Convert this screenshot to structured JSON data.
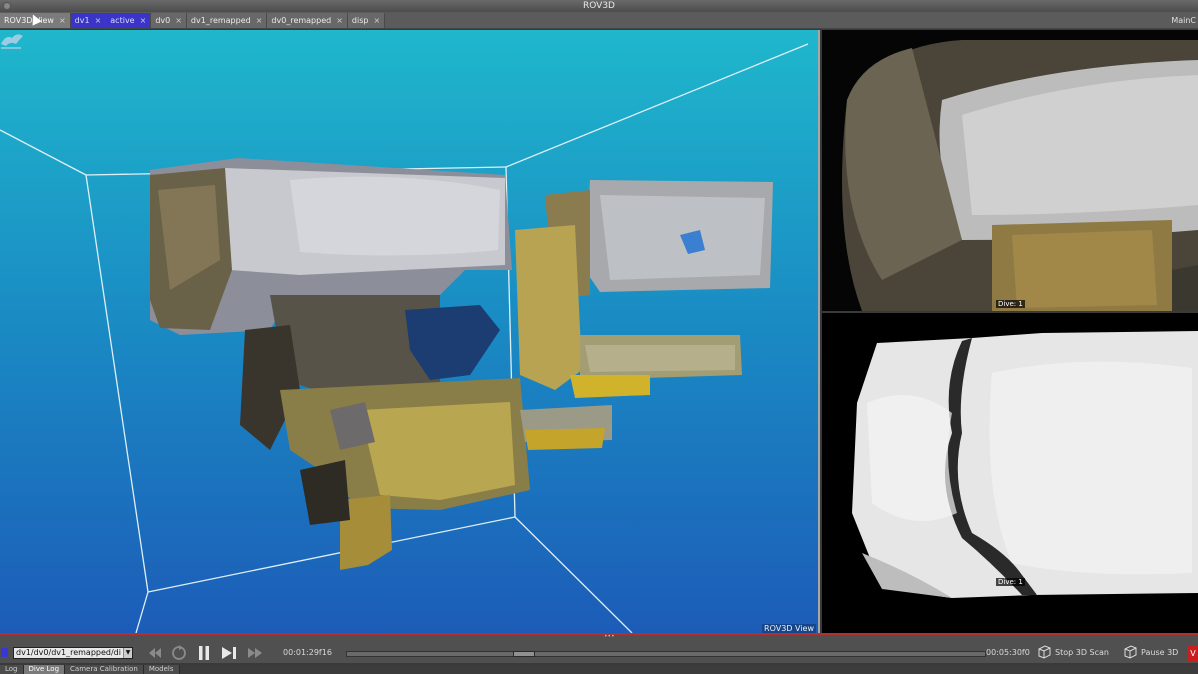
{
  "window": {
    "title": "ROV3D"
  },
  "tabs": [
    {
      "label": "ROV3D View",
      "style": "first"
    },
    {
      "label": "dv1",
      "style": "hl"
    },
    {
      "label": "active",
      "style": "hl"
    },
    {
      "label": "dv0",
      "style": "normal"
    },
    {
      "label": "dv1_remapped",
      "style": "normal"
    },
    {
      "label": "dv0_remapped",
      "style": "normal"
    },
    {
      "label": "disp",
      "style": "normal"
    }
  ],
  "tab_close": "×",
  "main_label": "MainC",
  "view3d": {
    "label": "ROV3D View"
  },
  "right_top": {
    "badge": "Dive: 1"
  },
  "right_bottom": {
    "badge": "Dive: 1"
  },
  "playback": {
    "path": "dv1/dv0/dv1_remapped/di",
    "current_time": "00:01:29f16",
    "end_time": "00:05:30f0",
    "progress": 0.27
  },
  "actions": {
    "stop_scan": "Stop 3D Scan",
    "pause_3d": "Pause 3D"
  },
  "bottom_tabs": [
    {
      "label": "Log",
      "active": false
    },
    {
      "label": "Dive Log",
      "active": true
    },
    {
      "label": "Camera Calibration",
      "active": false
    },
    {
      "label": "Models",
      "active": false
    }
  ],
  "colors": {
    "accent_red": "#c82020",
    "tab_highlight": "#3a35c8",
    "sky_top": "#1fb7cc",
    "sky_bottom": "#1c5cb8"
  }
}
